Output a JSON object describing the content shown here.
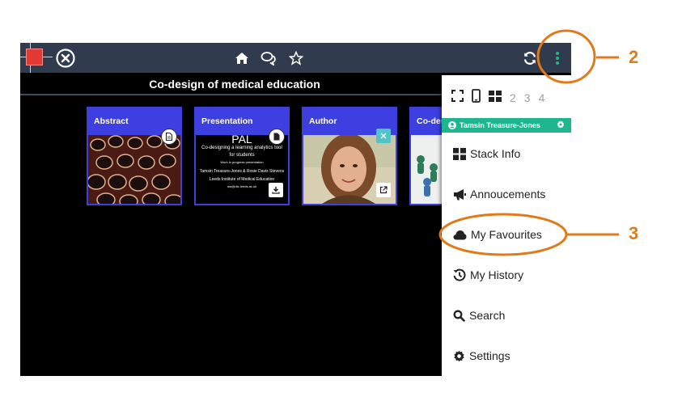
{
  "toolbar": {
    "icons": [
      "logo-icon",
      "close-icon",
      "home-icon",
      "chat-icon",
      "star-icon",
      "sync-icon",
      "more-vertical-icon"
    ]
  },
  "stack": {
    "title": "Co-design of medical education"
  },
  "cards": [
    {
      "title": "Abstract"
    },
    {
      "title": "Presentation",
      "slide_lines": [
        "PAL",
        "Co-designing a learning analytics tool",
        "for students",
        "Work in progress presentation",
        "Tamsin Treasure-Jones & Rosie Davis Stevens",
        "Leeds Institute of Medical Education",
        "ma@dtc.leeds.ac.uk"
      ]
    },
    {
      "title": "Author"
    },
    {
      "title": "Co-des"
    }
  ],
  "menu": {
    "layout_numbers": [
      "2",
      "3",
      "4"
    ],
    "user_name": "Tamsin Treasure-Jones",
    "items": [
      {
        "label": "Stack Info",
        "icon": "grid-icon"
      },
      {
        "label": "Annoucements",
        "icon": "megaphone-icon"
      },
      {
        "label": "My Favourites",
        "icon": "cloud-icon"
      },
      {
        "label": "My History",
        "icon": "history-icon"
      },
      {
        "label": "Search",
        "icon": "search-icon"
      },
      {
        "label": "Settings",
        "icon": "gear-icon"
      }
    ]
  },
  "annotations": [
    "2",
    "3"
  ],
  "colors": {
    "accent": "#e07b1c",
    "topbar": "#303b4d",
    "card_header": "#3d3fe0",
    "user_bar": "#1fb68f"
  }
}
